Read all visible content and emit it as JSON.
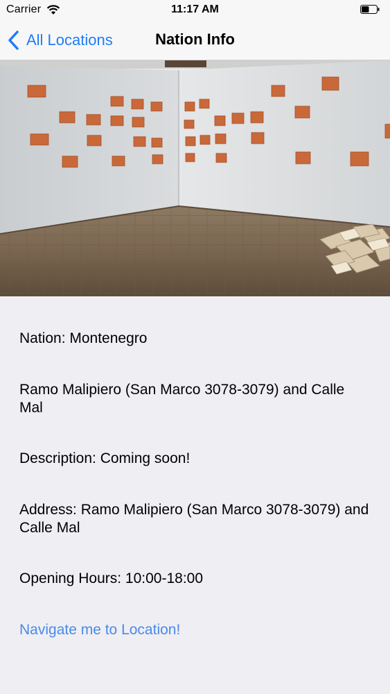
{
  "status_bar": {
    "carrier": "Carrier",
    "time": "11:17 AM",
    "wifi_icon": "wifi-icon",
    "battery_icon": "battery-icon",
    "battery_level": 0.5
  },
  "nav": {
    "back_label": "All Locations",
    "back_icon": "chevron-left-icon",
    "title": "Nation Info"
  },
  "hero_image": {
    "description": "gallery-room-photo"
  },
  "details": {
    "nation": "Nation: Montenegro",
    "venue": "Ramo Malipiero (San Marco 3078-3079) and Calle Mal",
    "description": "Description: Coming soon!",
    "address": "Address: Ramo Malipiero (San Marco 3078-3079) and Calle Mal",
    "hours": "Opening Hours: 10:00-18:00",
    "navigate_link": "Navigate me to Location!"
  },
  "colors": {
    "accent": "#1f7cf6",
    "link": "#4a8ae8",
    "background": "#efeef3",
    "bar": "#f7f7f8"
  }
}
